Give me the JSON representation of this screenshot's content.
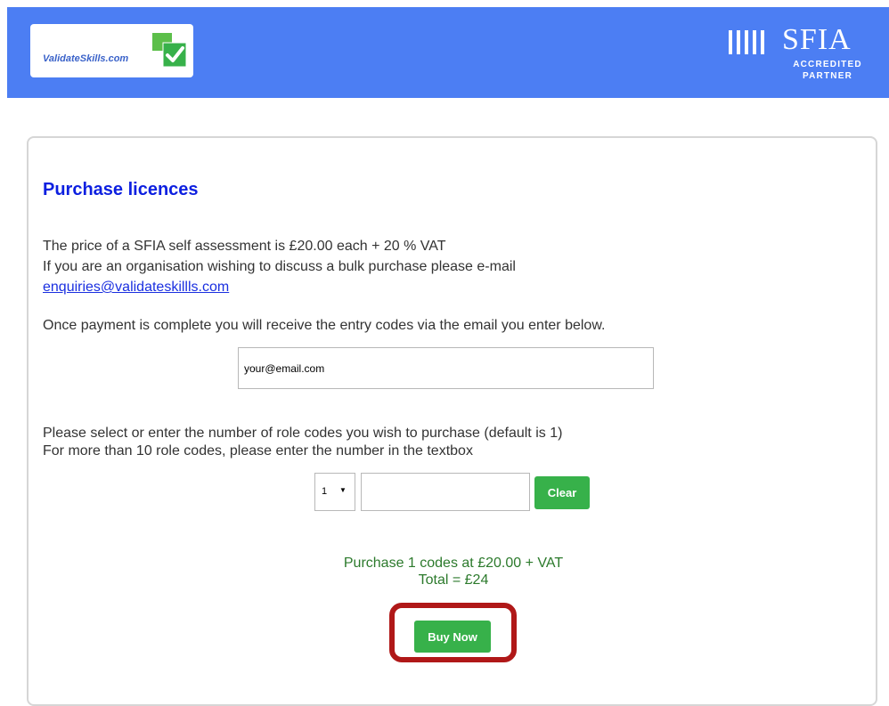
{
  "header": {
    "logo_text": "ValidateSkills.com",
    "partner_logo": {
      "word": "SFIA",
      "line1": "ACCREDITED",
      "line2": "PARTNER"
    },
    "background_color": "#4c7ef3"
  },
  "page": {
    "title": "Purchase licences",
    "price_line": "The price of a SFIA self assessment is £20.00 each + 20 % VAT",
    "bulk_line": "If you are an organisation wishing to discuss a bulk purchase please e-mail",
    "bulk_email": "enquiries@validateskillls.com",
    "payment_line": "Once payment is complete you will receive the entry codes via the email you enter below.",
    "email_input": {
      "value": "your@email.com"
    },
    "quantity_line1": "Please select or enter the number of role codes you wish to purchase (default is 1)",
    "quantity_line2": "For more than 10 role codes, please enter the number in the textbox",
    "quantity_select": {
      "selected": "1",
      "arrow_icon": "caret-down-icon"
    },
    "quantity_input": {
      "value": ""
    },
    "clear_label": "Clear",
    "summary_line1": "Purchase 1 codes at £20.00 + VAT",
    "summary_line2": "Total = £24",
    "buy_label": "Buy Now"
  },
  "colors": {
    "accent_green": "#37b14a",
    "title_blue": "#0c1fe0",
    "highlight_red": "#b01818"
  }
}
